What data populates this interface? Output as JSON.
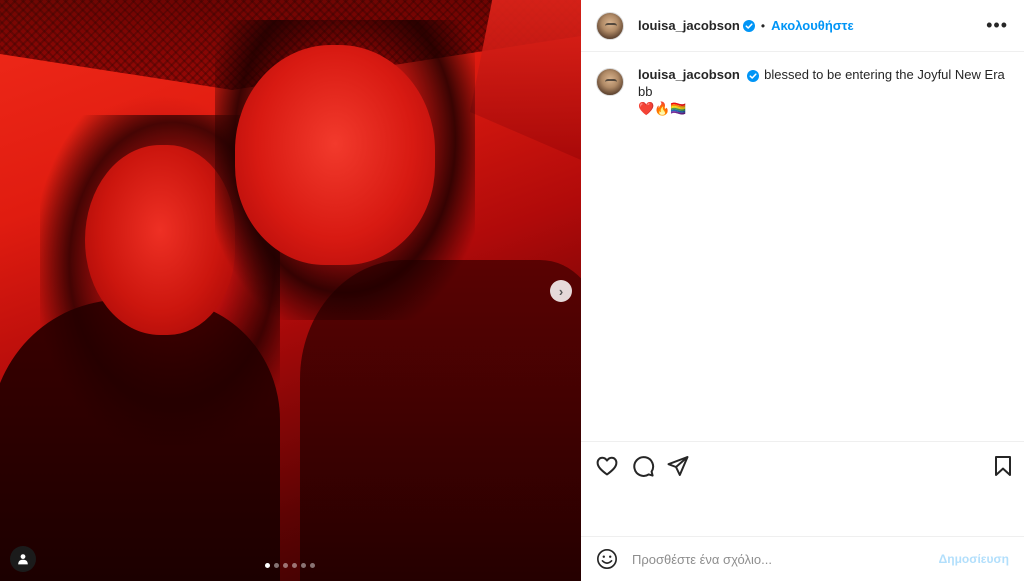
{
  "post": {
    "username": "louisa_jacobson",
    "separator": "•",
    "follow_label": "Ακολουθήστε",
    "more_label": "•••",
    "caption": "blessed to be entering the Joyful New Era bb",
    "caption_emojis": "❤️🔥🏳️‍🌈"
  },
  "carousel": {
    "slide_count": 6,
    "current_slide": 1,
    "next_label": "›"
  },
  "comment": {
    "placeholder": "Προσθέστε ένα σχόλιο...",
    "post_label": "Δημοσίευση"
  },
  "colors": {
    "accent": "#0095f6",
    "post_disabled": "#b2dffc",
    "text": "#262626",
    "muted": "#8e8e8e"
  },
  "icons": [
    "verified-badge-icon",
    "more-options-icon",
    "heart-icon",
    "comment-icon",
    "share-icon",
    "bookmark-icon",
    "emoji-icon",
    "tagged-user-icon",
    "chevron-right-icon"
  ]
}
